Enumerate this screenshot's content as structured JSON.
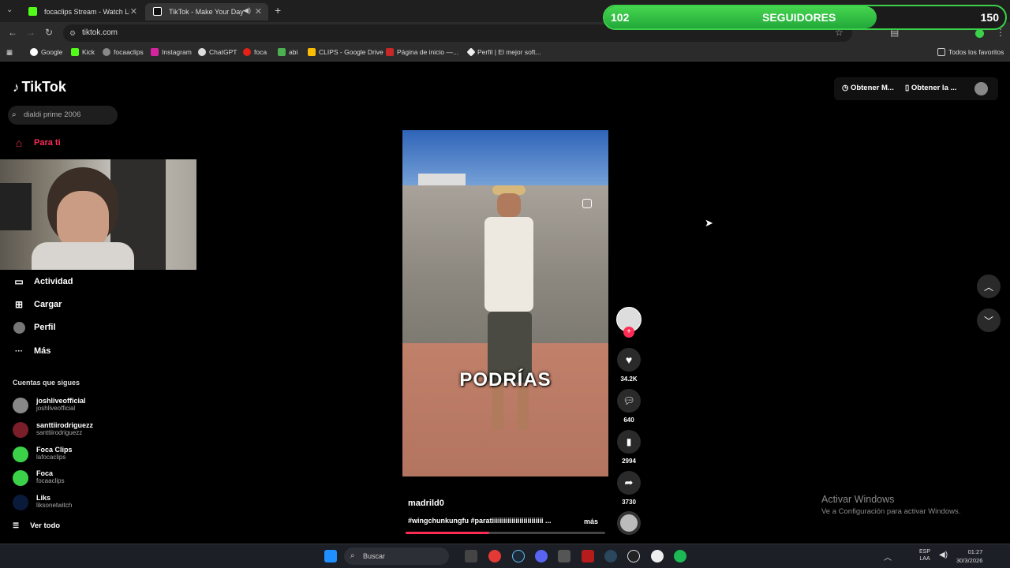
{
  "browser": {
    "tabs": [
      {
        "title": "focaclips Stream - Watch Live o",
        "favicon_color": "#53fc18",
        "active": false
      },
      {
        "title": "TikTok - Make Your Day",
        "favicon_color": "#ffffff",
        "active": true
      }
    ],
    "new_tab_icon": "plus-icon",
    "url": "tiktok.com",
    "bookmarks": [
      "Google",
      "Kick",
      "focaaclips",
      "Instagram",
      "ChatGPT",
      "foca",
      "abi",
      "CLIPS - Google Drive",
      "Página de inicio —...",
      "Perfil | El mejor soft..."
    ],
    "bookmarks_folder": "Todos los favoritos"
  },
  "overlay": {
    "followers": "102",
    "label": "SEGUIDORES",
    "goal": "150",
    "progress": 0.68
  },
  "tiktok": {
    "logo": "TikTok",
    "search_placeholder": "dialdi prime 2006",
    "nav": {
      "for_you": "Para ti",
      "activity": "Actividad",
      "upload": "Cargar",
      "profile": "Perfil",
      "more": "Más"
    },
    "following_header": "Cuentas que sigues",
    "following": [
      {
        "name": "joshliveofficial",
        "handle": "joshliveofficial"
      },
      {
        "name": "santtiirodriguezz",
        "handle": "santtiirodriguezz"
      },
      {
        "name": "Foca Clips",
        "handle": "lafocaclips"
      },
      {
        "name": "Foca",
        "handle": "focaaclips"
      },
      {
        "name": "Liks",
        "handle": "liksonetwitch"
      }
    ],
    "see_all": "Ver todo",
    "top_buttons": [
      "Obtener M...",
      "Obtener la ..."
    ],
    "video": {
      "caption": "PODRÍAS",
      "author": "madrild0",
      "description": "#wingchunkungfu #paratiiiiiiiiiiiiiiiiiiiiiiiiii ...",
      "more": "más",
      "progress": 0.42,
      "likes": "34.2K",
      "comments": "640",
      "saves": "2994",
      "shares": "3730"
    }
  },
  "windows": {
    "activate_title": "Activar Windows",
    "activate_sub": "Ve a Configuración para activar Windows.",
    "search_placeholder": "Buscar",
    "time": "01:27",
    "date": "30/3/2026",
    "lang_top": "ESP",
    "lang_bottom": "LAA"
  }
}
